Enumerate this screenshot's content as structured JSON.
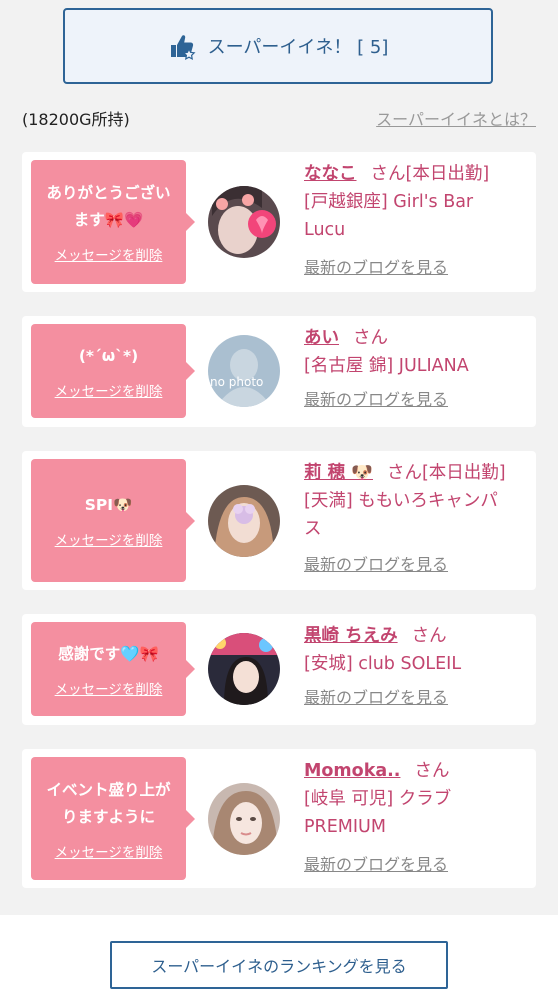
{
  "super_like": {
    "label": "スーパーイイネ！ [ 5]",
    "icon": "thumbs-up-star-icon"
  },
  "points_text": "(18200G所持)",
  "what_is_link": "スーパーイイネとは？",
  "delete_label": "メッセージを削除",
  "blog_label": "最新のブログを見る",
  "san": "さん",
  "cards": [
    {
      "message_lines": [
        "ありがとうござい",
        "ます🎀💗"
      ],
      "name": "ななこ",
      "san": "さん[本日出勤]",
      "shop_lines": [
        "[戸越銀座] Girl's Bar",
        "Lucu"
      ],
      "avatar_caption": ""
    },
    {
      "message_lines": [
        "(*´ω`*)"
      ],
      "name": "あい",
      "san": "さん",
      "shop_lines": [
        "[名古屋 錦] JULIANA"
      ],
      "avatar_caption": "no photo"
    },
    {
      "message_lines": [
        "SPI🐶"
      ],
      "name": "莉 穂 🐶",
      "san": "さん[本日出勤]",
      "shop_lines": [
        "[天満] ももいろキャンパ",
        "ス"
      ],
      "avatar_caption": ""
    },
    {
      "message_lines": [
        "感謝です🩵🎀"
      ],
      "name": "黒崎 ちえみ",
      "san": "さん",
      "shop_lines": [
        "[安城] club SOLEIL"
      ],
      "avatar_caption": ""
    },
    {
      "message_lines": [
        "イベント盛り上が",
        "りますように"
      ],
      "name": "Momoka..",
      "san": "さん",
      "shop_lines": [
        "[岐阜 可児] クラブ",
        "PREMIUM"
      ],
      "avatar_caption": ""
    }
  ],
  "ranking_button": "スーパーイイネのランキングを見る",
  "colors": {
    "accent_blue": "#2e6496",
    "pink_bubble": "#f48fa0",
    "pink_text": "#c2456f"
  }
}
